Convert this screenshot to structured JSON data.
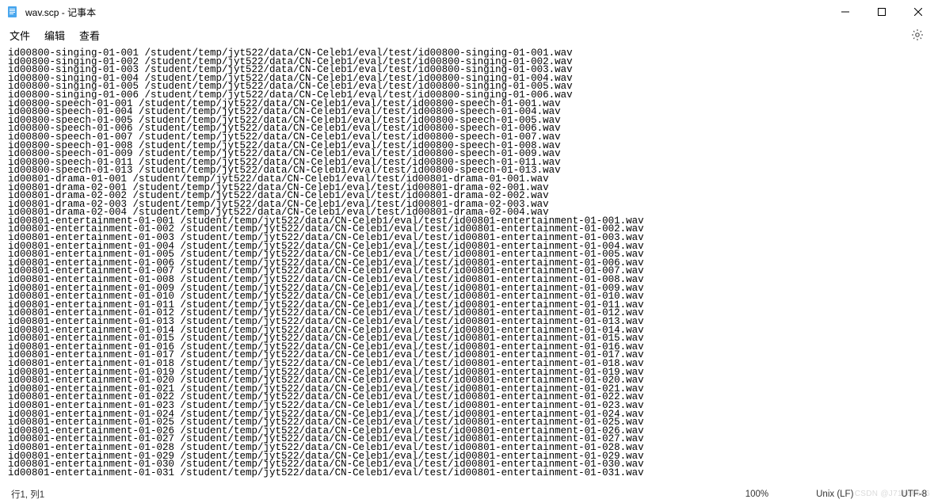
{
  "title": "wav.scp - 记事本",
  "menu": {
    "file": "文件",
    "edit": "编辑",
    "view": "查看"
  },
  "status": {
    "pos": "行1, 列1",
    "zoom": "100%",
    "eol": "Unix (LF)",
    "enc": "UTF-8"
  },
  "watermark": "CSDN @J71666666",
  "lines": [
    "id00800-singing-01-001 /student/temp/jyt522/data/CN-Celeb1/eval/test/id00800-singing-01-001.wav",
    "id00800-singing-01-002 /student/temp/jyt522/data/CN-Celeb1/eval/test/id00800-singing-01-002.wav",
    "id00800-singing-01-003 /student/temp/jyt522/data/CN-Celeb1/eval/test/id00800-singing-01-003.wav",
    "id00800-singing-01-004 /student/temp/jyt522/data/CN-Celeb1/eval/test/id00800-singing-01-004.wav",
    "id00800-singing-01-005 /student/temp/jyt522/data/CN-Celeb1/eval/test/id00800-singing-01-005.wav",
    "id00800-singing-01-006 /student/temp/jyt522/data/CN-Celeb1/eval/test/id00800-singing-01-006.wav",
    "id00800-speech-01-001 /student/temp/jyt522/data/CN-Celeb1/eval/test/id00800-speech-01-001.wav",
    "id00800-speech-01-004 /student/temp/jyt522/data/CN-Celeb1/eval/test/id00800-speech-01-004.wav",
    "id00800-speech-01-005 /student/temp/jyt522/data/CN-Celeb1/eval/test/id00800-speech-01-005.wav",
    "id00800-speech-01-006 /student/temp/jyt522/data/CN-Celeb1/eval/test/id00800-speech-01-006.wav",
    "id00800-speech-01-007 /student/temp/jyt522/data/CN-Celeb1/eval/test/id00800-speech-01-007.wav",
    "id00800-speech-01-008 /student/temp/jyt522/data/CN-Celeb1/eval/test/id00800-speech-01-008.wav",
    "id00800-speech-01-009 /student/temp/jyt522/data/CN-Celeb1/eval/test/id00800-speech-01-009.wav",
    "id00800-speech-01-011 /student/temp/jyt522/data/CN-Celeb1/eval/test/id00800-speech-01-011.wav",
    "id00800-speech-01-013 /student/temp/jyt522/data/CN-Celeb1/eval/test/id00800-speech-01-013.wav",
    "id00801-drama-01-001 /student/temp/jyt522/data/CN-Celeb1/eval/test/id00801-drama-01-001.wav",
    "id00801-drama-02-001 /student/temp/jyt522/data/CN-Celeb1/eval/test/id00801-drama-02-001.wav",
    "id00801-drama-02-002 /student/temp/jyt522/data/CN-Celeb1/eval/test/id00801-drama-02-002.wav",
    "id00801-drama-02-003 /student/temp/jyt522/data/CN-Celeb1/eval/test/id00801-drama-02-003.wav",
    "id00801-drama-02-004 /student/temp/jyt522/data/CN-Celeb1/eval/test/id00801-drama-02-004.wav",
    "id00801-entertainment-01-001 /student/temp/jyt522/data/CN-Celeb1/eval/test/id00801-entertainment-01-001.wav",
    "id00801-entertainment-01-002 /student/temp/jyt522/data/CN-Celeb1/eval/test/id00801-entertainment-01-002.wav",
    "id00801-entertainment-01-003 /student/temp/jyt522/data/CN-Celeb1/eval/test/id00801-entertainment-01-003.wav",
    "id00801-entertainment-01-004 /student/temp/jyt522/data/CN-Celeb1/eval/test/id00801-entertainment-01-004.wav",
    "id00801-entertainment-01-005 /student/temp/jyt522/data/CN-Celeb1/eval/test/id00801-entertainment-01-005.wav",
    "id00801-entertainment-01-006 /student/temp/jyt522/data/CN-Celeb1/eval/test/id00801-entertainment-01-006.wav",
    "id00801-entertainment-01-007 /student/temp/jyt522/data/CN-Celeb1/eval/test/id00801-entertainment-01-007.wav",
    "id00801-entertainment-01-008 /student/temp/jyt522/data/CN-Celeb1/eval/test/id00801-entertainment-01-008.wav",
    "id00801-entertainment-01-009 /student/temp/jyt522/data/CN-Celeb1/eval/test/id00801-entertainment-01-009.wav",
    "id00801-entertainment-01-010 /student/temp/jyt522/data/CN-Celeb1/eval/test/id00801-entertainment-01-010.wav",
    "id00801-entertainment-01-011 /student/temp/jyt522/data/CN-Celeb1/eval/test/id00801-entertainment-01-011.wav",
    "id00801-entertainment-01-012 /student/temp/jyt522/data/CN-Celeb1/eval/test/id00801-entertainment-01-012.wav",
    "id00801-entertainment-01-013 /student/temp/jyt522/data/CN-Celeb1/eval/test/id00801-entertainment-01-013.wav",
    "id00801-entertainment-01-014 /student/temp/jyt522/data/CN-Celeb1/eval/test/id00801-entertainment-01-014.wav",
    "id00801-entertainment-01-015 /student/temp/jyt522/data/CN-Celeb1/eval/test/id00801-entertainment-01-015.wav",
    "id00801-entertainment-01-016 /student/temp/jyt522/data/CN-Celeb1/eval/test/id00801-entertainment-01-016.wav",
    "id00801-entertainment-01-017 /student/temp/jyt522/data/CN-Celeb1/eval/test/id00801-entertainment-01-017.wav",
    "id00801-entertainment-01-018 /student/temp/jyt522/data/CN-Celeb1/eval/test/id00801-entertainment-01-018.wav",
    "id00801-entertainment-01-019 /student/temp/jyt522/data/CN-Celeb1/eval/test/id00801-entertainment-01-019.wav",
    "id00801-entertainment-01-020 /student/temp/jyt522/data/CN-Celeb1/eval/test/id00801-entertainment-01-020.wav",
    "id00801-entertainment-01-021 /student/temp/jyt522/data/CN-Celeb1/eval/test/id00801-entertainment-01-021.wav",
    "id00801-entertainment-01-022 /student/temp/jyt522/data/CN-Celeb1/eval/test/id00801-entertainment-01-022.wav",
    "id00801-entertainment-01-023 /student/temp/jyt522/data/CN-Celeb1/eval/test/id00801-entertainment-01-023.wav",
    "id00801-entertainment-01-024 /student/temp/jyt522/data/CN-Celeb1/eval/test/id00801-entertainment-01-024.wav",
    "id00801-entertainment-01-025 /student/temp/jyt522/data/CN-Celeb1/eval/test/id00801-entertainment-01-025.wav",
    "id00801-entertainment-01-026 /student/temp/jyt522/data/CN-Celeb1/eval/test/id00801-entertainment-01-026.wav",
    "id00801-entertainment-01-027 /student/temp/jyt522/data/CN-Celeb1/eval/test/id00801-entertainment-01-027.wav",
    "id00801-entertainment-01-028 /student/temp/jyt522/data/CN-Celeb1/eval/test/id00801-entertainment-01-028.wav",
    "id00801-entertainment-01-029 /student/temp/jyt522/data/CN-Celeb1/eval/test/id00801-entertainment-01-029.wav",
    "id00801-entertainment-01-030 /student/temp/jyt522/data/CN-Celeb1/eval/test/id00801-entertainment-01-030.wav",
    "id00801-entertainment-01-031 /student/temp/jyt522/data/CN-Celeb1/eval/test/id00801-entertainment-01-031.wav"
  ]
}
